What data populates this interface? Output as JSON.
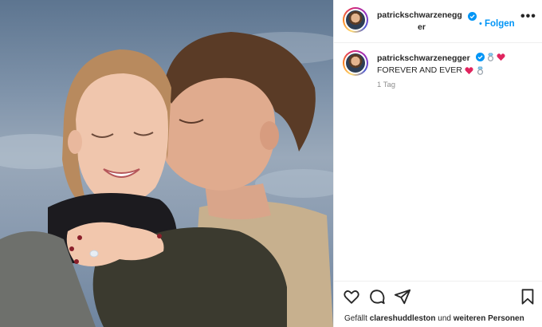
{
  "post": {
    "username": "patrickschwarzenegger",
    "username_line1": "patrickschwarzenegg",
    "username_line2": "er",
    "follow_label": "Folgen",
    "follow_separator": "•",
    "more_label": "•••",
    "caption_text": "FOREVER AND EVER",
    "time_ago": "1 Tag",
    "likes_prefix": "Gefällt",
    "likes_user": "clareshuddleston",
    "likes_connector": "und",
    "likes_others": "weiteren Personen"
  },
  "icons": {
    "verified": "verified-badge-icon",
    "heart": "heart-icon",
    "comment": "comment-icon",
    "share": "share-icon",
    "save": "bookmark-icon",
    "ring": "ring-emoji-icon",
    "red_heart": "red-heart-emoji-icon"
  },
  "colors": {
    "accent": "#0095f6",
    "verified": "#0095f6",
    "emoji_heart": "#e0245e",
    "muted": "#8e8e8e"
  }
}
